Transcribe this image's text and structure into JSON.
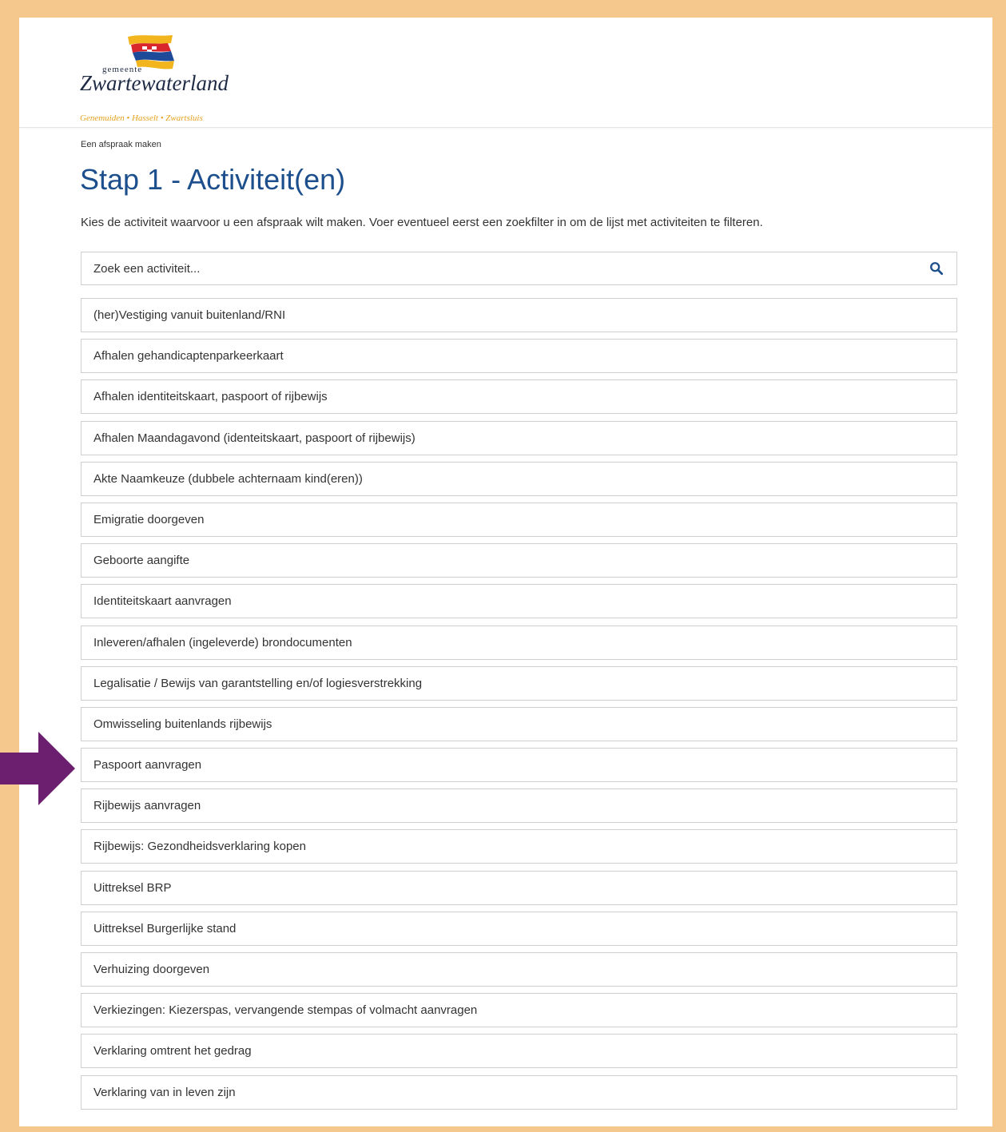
{
  "logo": {
    "gemeente": "gemeente",
    "name": "Zwartewaterland",
    "places": "Genemuiden • Hasselt • Zwartsluis"
  },
  "breadcrumb": "Een afspraak maken",
  "title": "Stap 1 - Activiteit(en)",
  "intro": "Kies de activiteit waarvoor u een afspraak wilt maken. Voer eventueel eerst een zoekfilter in om de lijst met activiteiten te filteren.",
  "search": {
    "placeholder": "Zoek een activiteit...",
    "value": "",
    "icon": "search-icon"
  },
  "activities": [
    "(her)Vestiging vanuit buitenland/RNI",
    "Afhalen gehandicaptenparkeerkaart",
    "Afhalen identiteitskaart, paspoort of rijbewijs",
    "Afhalen Maandagavond (identeitskaart, paspoort of rijbewijs)",
    "Akte Naamkeuze (dubbele achternaam kind(eren))",
    "Emigratie doorgeven",
    "Geboorte aangifte",
    "Identiteitskaart aanvragen",
    "Inleveren/afhalen (ingeleverde) brondocumenten",
    "Legalisatie / Bewijs van garantstelling en/of logiesverstrekking",
    "Omwisseling buitenlands rijbewijs",
    "Paspoort aanvragen",
    "Rijbewijs aanvragen",
    "Rijbewijs: Gezondheidsverklaring kopen",
    "Uittreksel BRP",
    "Uittreksel Burgerlijke stand",
    "Verhuizing doorgeven",
    "Verkiezingen: Kiezerspas, vervangende stempas of volmacht aanvragen",
    "Verklaring omtrent het gedrag",
    "Verklaring van in leven zijn"
  ],
  "highlighted_item": "Paspoort aanvragen",
  "colors": {
    "frame": "#f5c98e",
    "title": "#1c4f8c",
    "arrow": "#6b1f6e",
    "search_icon": "#1c4f8c",
    "logo_text": "#1e2a44",
    "logo_sub": "#e6a21e"
  }
}
